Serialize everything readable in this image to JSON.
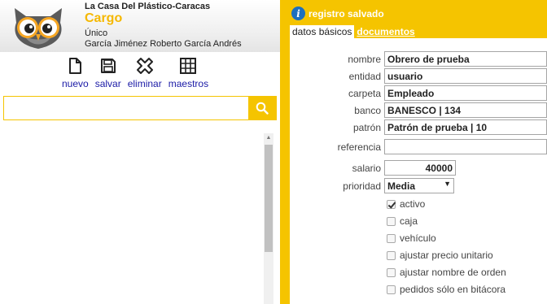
{
  "header": {
    "company": "La Casa Del Plástico-Caracas",
    "module": "Cargo",
    "subtitle1": "Único",
    "subtitle2": "García Jiménez Roberto García Andrés",
    "logo": "owl-logo"
  },
  "toolbar": {
    "nuevo_label": "nuevo",
    "salvar_label": "salvar",
    "eliminar_label": "eliminar",
    "maestros_label": "maestros",
    "icons": [
      "document-icon",
      "save-icon",
      "delete-icon",
      "grid-icon"
    ]
  },
  "search": {
    "value": "",
    "icon": "search-icon"
  },
  "status": {
    "text": "registro salvado",
    "icon": "info-icon"
  },
  "tabs": [
    {
      "label": "datos básicos",
      "active": true
    },
    {
      "label": "documentos",
      "active": false
    }
  ],
  "form": {
    "nombre": {
      "label": "nombre",
      "value": "Obrero de prueba"
    },
    "entidad": {
      "label": "entidad",
      "value": "usuario"
    },
    "carpeta": {
      "label": "carpeta",
      "value": "Empleado"
    },
    "banco": {
      "label": "banco",
      "value": "BANESCO | 134"
    },
    "patron": {
      "label": "patrón",
      "value": "Patrón de prueba | 10"
    },
    "referencia": {
      "label": "referencia",
      "value": ""
    },
    "salario": {
      "label": "salario",
      "value": "40000"
    },
    "prioridad": {
      "label": "prioridad",
      "value": "Media"
    }
  },
  "checkboxes": [
    {
      "label": "activo",
      "checked": true
    },
    {
      "label": "caja",
      "checked": false
    },
    {
      "label": "vehículo",
      "checked": false
    },
    {
      "label": "ajustar precio unitario",
      "checked": false
    },
    {
      "label": "ajustar nombre de orden",
      "checked": false
    },
    {
      "label": "pedidos sólo en bitácora",
      "checked": false
    }
  ],
  "colors": {
    "accent": "#f5c400",
    "module_title": "#f5b800",
    "link": "#1a1aa6",
    "info": "#1c6fbf"
  }
}
